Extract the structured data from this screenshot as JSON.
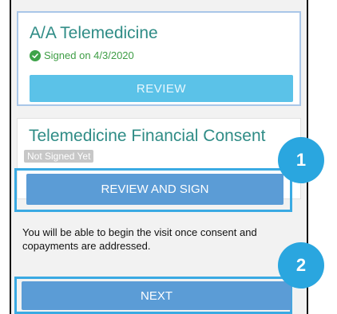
{
  "card_aa": {
    "title": "A/A Telemedicine",
    "status": "Signed on 4/3/2020",
    "review_label": "REVIEW"
  },
  "card_financial": {
    "title": "Telemedicine Financial Consent",
    "status": "Not Signed Yet",
    "review_sign_label": "REVIEW AND SIGN"
  },
  "info_text": "You will be able to begin the visit once consent and copayments are addressed.",
  "next_label": "NEXT",
  "steps": [
    "1",
    "2"
  ],
  "colors": {
    "title": "#2f8c86",
    "signed_green": "#3fa34a",
    "review_button": "#5bc2e8",
    "primary_button": "#5b9cd6",
    "highlight": "#3aaae3"
  }
}
